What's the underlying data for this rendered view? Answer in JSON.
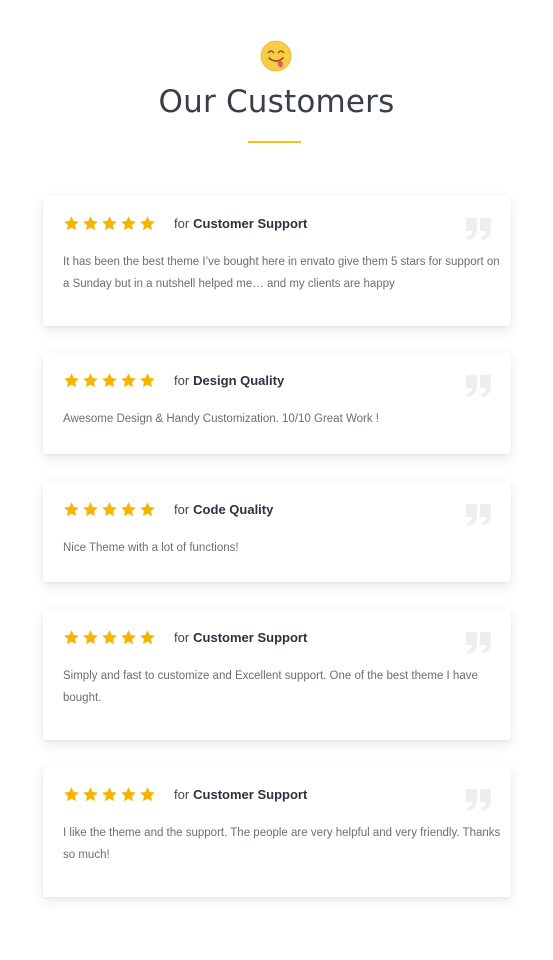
{
  "header": {
    "icon": "yum-face-emoji-icon",
    "title": "Our Customers",
    "accent_color": "#f3c31a"
  },
  "reviews": [
    {
      "rating": 5,
      "for_label": "for",
      "category": "Customer Support",
      "text": "It has been the best theme I’ve bought here in envato give them 5 stars for support on a Sunday but in a nutshell helped me… and my clients are happy"
    },
    {
      "rating": 5,
      "for_label": "for",
      "category": "Design Quality",
      "text": "Awesome Design & Handy Customization. 10/10 Great Work !"
    },
    {
      "rating": 5,
      "for_label": "for",
      "category": "Code Quality",
      "text": "Nice Theme with a lot of functions!"
    },
    {
      "rating": 5,
      "for_label": "for",
      "category": "Customer Support",
      "text": "Simply and fast to customize and Excellent support. One of the best theme I have bought."
    },
    {
      "rating": 5,
      "for_label": "for",
      "category": "Customer Support",
      "text": "I like the theme and the support. The people are very helpful and very friendly. Thanks so much!"
    }
  ],
  "colors": {
    "star": "#f5b400",
    "quote": "#eceef1",
    "title": "#3a3d4a"
  }
}
